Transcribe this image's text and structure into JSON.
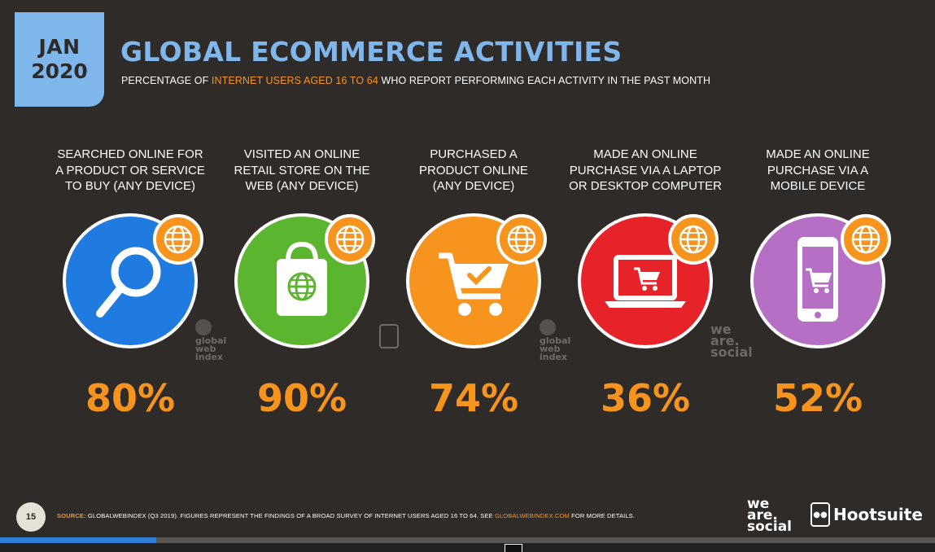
{
  "header": {
    "month": "JAN",
    "year": "2020",
    "title": "GLOBAL ECOMMERCE ACTIVITIES",
    "subtitle_pre": "PERCENTAGE OF ",
    "subtitle_highlight": "INTERNET USERS AGED 16 TO 64",
    "subtitle_post": " WHO REPORT PERFORMING EACH ACTIVITY IN THE PAST MONTH"
  },
  "activities": [
    {
      "label": "SEARCHED ONLINE FOR\nA PRODUCT OR SERVICE\nTO BUY (ANY DEVICE)",
      "value": "80%",
      "color": "#1f7be0",
      "icon": "magnifier-icon"
    },
    {
      "label": "VISITED AN ONLINE\nRETAIL STORE ON THE\nWEB (ANY DEVICE)",
      "value": "90%",
      "color": "#5bb52e",
      "icon": "shopping-bag-icon"
    },
    {
      "label": "PURCHASED A\nPRODUCT ONLINE\n(ANY DEVICE)",
      "value": "74%",
      "color": "#f7941d",
      "icon": "shopping-cart-icon"
    },
    {
      "label": "MADE AN ONLINE\nPURCHASE VIA A LAPTOP\nOR DESKTOP COMPUTER",
      "value": "36%",
      "color": "#e7232a",
      "icon": "laptop-cart-icon"
    },
    {
      "label": "MADE AN ONLINE\nPURCHASE VIA A\nMOBILE DEVICE",
      "value": "52%",
      "color": "#b56fc5",
      "icon": "mobile-cart-icon"
    }
  ],
  "watermarks": {
    "gwi": "global\nweb\nindex",
    "was": "we\nare.\nsocial"
  },
  "footer": {
    "page_number": "15",
    "source_label": "SOURCE:",
    "source_text": " GLOBALWEBINDEX (Q3 2019). FIGURES REPRESENT THE FINDINGS OF A BROAD SURVEY OF INTERNET USERS AGED 16 TO 64. SEE ",
    "source_link": "GLOBALWEBINDEX.COM",
    "source_tail": " FOR MORE DETAILS.",
    "logo_was": "we\nare.\nsocial",
    "logo_hootsuite": "Hootsuite"
  },
  "slide_progress": 0.167,
  "colors": {
    "accent_blue": "#7fb6ec",
    "accent_orange": "#f7941d",
    "background": "#2f2b28"
  }
}
